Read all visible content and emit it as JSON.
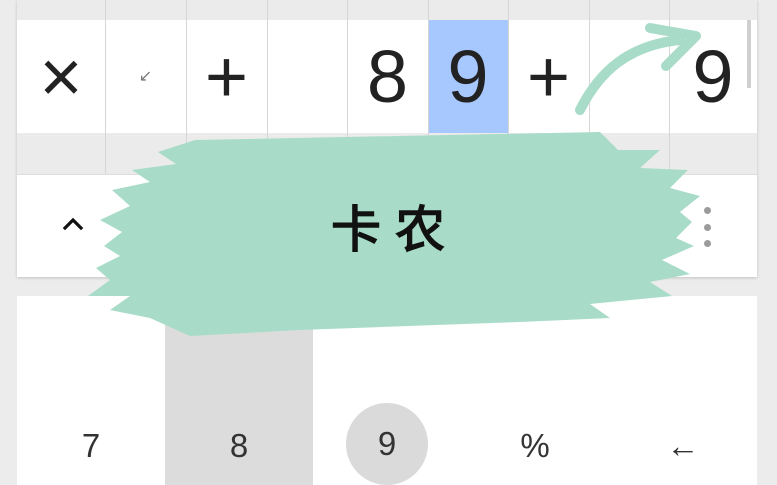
{
  "expression": {
    "cells": [
      {
        "text": "×",
        "small": false,
        "selected": false
      },
      {
        "text": "↙",
        "small": true,
        "selected": false
      },
      {
        "text": "+",
        "small": false,
        "selected": false
      },
      {
        "text": "",
        "small": false,
        "selected": false
      },
      {
        "text": "8",
        "small": false,
        "selected": false
      },
      {
        "text": "9",
        "small": false,
        "selected": true
      },
      {
        "text": "+",
        "small": false,
        "selected": false
      },
      {
        "text": "",
        "small": false,
        "selected": false
      },
      {
        "text": "9",
        "small": false,
        "selected": false
      }
    ]
  },
  "keypad": {
    "keys": [
      "7",
      "8",
      "9",
      "%",
      "←"
    ],
    "pressed_index": 1,
    "circled_index": 2
  },
  "overlay": {
    "watermark_text": "卡农",
    "brush_color": "#a8dcc8"
  },
  "icons": {
    "expand": "chevron-up-icon",
    "more": "more-vert-icon"
  },
  "colors": {
    "selection": "#a7c7ff",
    "brush": "#a8dcc8",
    "pressed_key": "#dcdcdc"
  }
}
